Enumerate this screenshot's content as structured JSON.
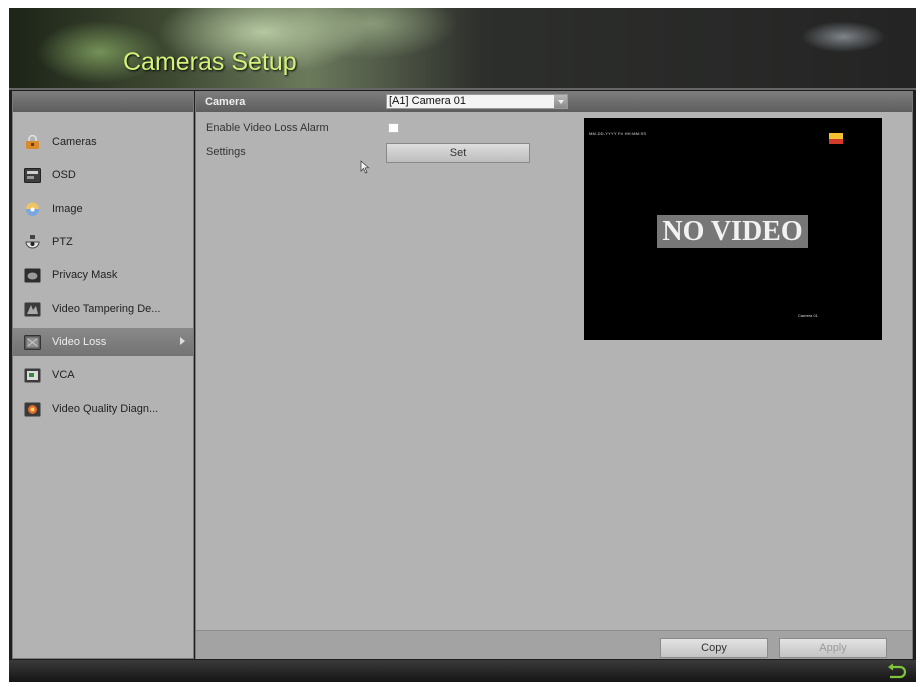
{
  "window": {
    "title": "Cameras Setup"
  },
  "sidebar": {
    "items": [
      {
        "label": "Cameras",
        "icon": "camera-lock-icon",
        "active": false
      },
      {
        "label": "OSD",
        "icon": "osd-icon",
        "active": false
      },
      {
        "label": "Image",
        "icon": "image-icon",
        "active": false
      },
      {
        "label": "PTZ",
        "icon": "ptz-dome-icon",
        "active": false
      },
      {
        "label": "Privacy Mask",
        "icon": "privacy-mask-icon",
        "active": false
      },
      {
        "label": "Video Tampering De...",
        "icon": "video-tampering-icon",
        "active": false
      },
      {
        "label": "Video Loss",
        "icon": "video-loss-icon",
        "active": true
      },
      {
        "label": "VCA",
        "icon": "vca-icon",
        "active": false
      },
      {
        "label": "Video Quality Diagn...",
        "icon": "video-quality-icon",
        "active": false
      }
    ]
  },
  "main": {
    "camera_label": "Camera",
    "camera_value": "[A1] Camera 01",
    "enable_alarm_label": "Enable Video Loss Alarm",
    "enable_alarm_checked": false,
    "settings_label": "Settings",
    "set_button_label": "Set",
    "preview": {
      "no_video_text": "NO VIDEO",
      "osd_datetime": "MM-DD-YYYY Fri HH:MM:SS",
      "osd_camera_name": "Camera 01"
    }
  },
  "footer": {
    "copy_label": "Copy",
    "apply_label": "Apply"
  },
  "colors": {
    "title": "#d4f17a",
    "panel": "#b3b3b3",
    "header": "#6d6d6d",
    "active_item": "#808080"
  }
}
